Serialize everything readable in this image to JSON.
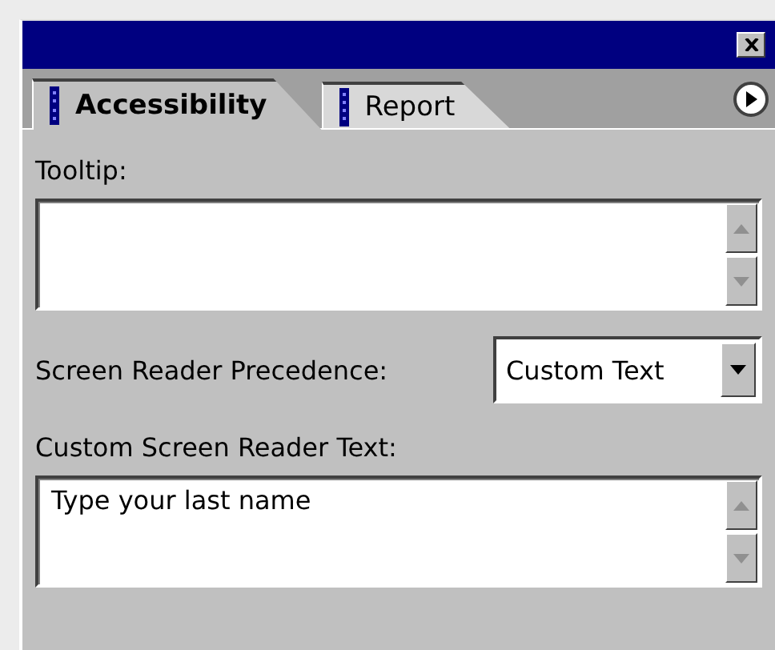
{
  "tabs": [
    {
      "label": "Accessibility",
      "selected": true
    },
    {
      "label": "Report",
      "selected": false
    }
  ],
  "tooltip": {
    "label": "Tooltip:"
  },
  "precedence": {
    "label": "Screen Reader Precedence:",
    "value": "Custom Text"
  },
  "custom_text": {
    "label": "Custom Screen Reader Text:",
    "value": "Type your last name"
  }
}
